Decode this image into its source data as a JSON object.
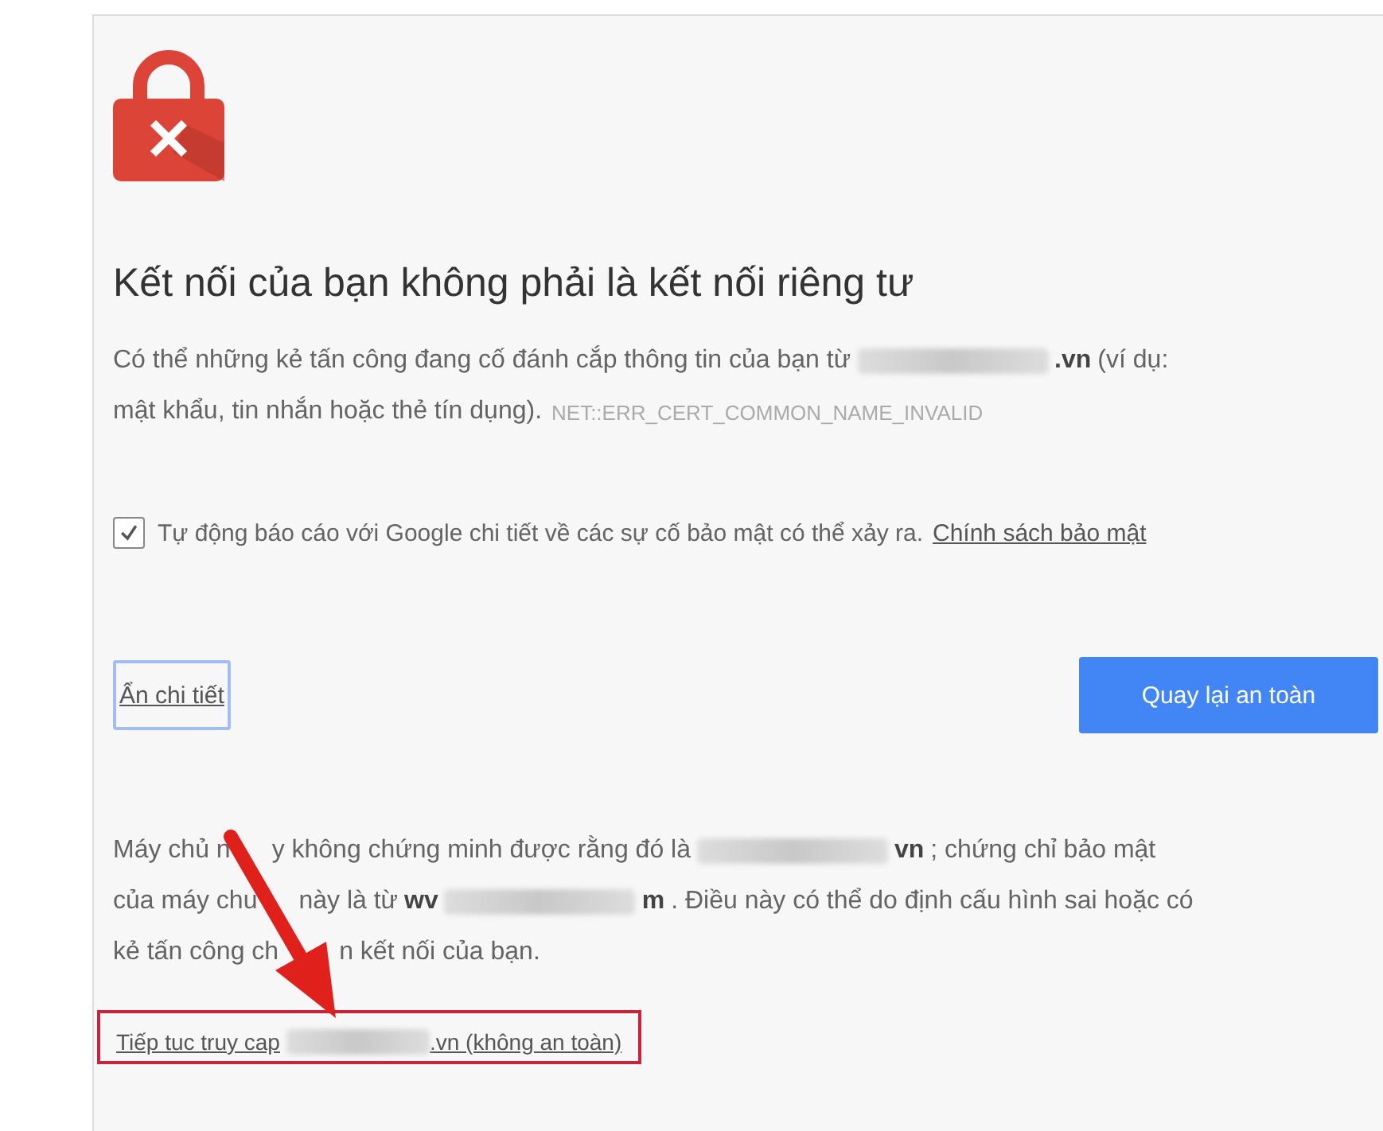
{
  "heading": "Kết nối của bạn không phải là kết nối riêng tư",
  "intro": [
    [
      {
        "kind": "text",
        "text": "Có thể những kẻ tấn công đang cố đánh cắp thông tin của bạn từ"
      },
      {
        "kind": "redacted"
      },
      {
        "kind": "bold",
        "text": ".vn"
      },
      {
        "kind": "text",
        "text": "(ví dụ:"
      }
    ],
    [
      {
        "kind": "text",
        "text": "mật khẩu, tin nhắn hoặc thẻ tín dụng)."
      },
      {
        "kind": "code",
        "text": "NET::ERR_CERT_COMMON_NAME_INVALID"
      }
    ]
  ],
  "report": {
    "checked": true,
    "label": "Tự động báo cáo với Google chi tiết về các sự cố bảo mật có thể xảy ra.",
    "link": "Chính sách bảo mật"
  },
  "details_link": "Ẩn chi tiết",
  "back_button": "Quay lại an toàn",
  "details": [
    [
      {
        "kind": "text",
        "text": "Máy chủ n"
      },
      {
        "kind": "covered"
      },
      {
        "kind": "text",
        "text": "y không chứng minh được rằng đó là"
      },
      {
        "kind": "redacted"
      },
      {
        "kind": "bold",
        "text": "vn"
      },
      {
        "kind": "text",
        "text": "; chứng chỉ bảo mật"
      }
    ],
    [
      {
        "kind": "text",
        "text": "của máy chu"
      },
      {
        "kind": "covered"
      },
      {
        "kind": "text",
        "text": "này là từ"
      },
      {
        "kind": "bold",
        "text": "wv"
      },
      {
        "kind": "redacted"
      },
      {
        "kind": "bold",
        "text": "m"
      },
      {
        "kind": "text",
        "text": ". Điều này có thể do định cấu hình sai hoặc có"
      }
    ],
    [
      {
        "kind": "text",
        "text": "kẻ tấn công ch"
      },
      {
        "kind": "covered"
      },
      {
        "kind": "text",
        "text": "n kết nối của bạn."
      }
    ]
  ],
  "proceed": [
    {
      "kind": "text",
      "text": "Tiếp tuc truy cap"
    },
    {
      "kind": "redacted"
    },
    {
      "kind": "text",
      "text": ".vn (không an toàn)"
    }
  ]
}
